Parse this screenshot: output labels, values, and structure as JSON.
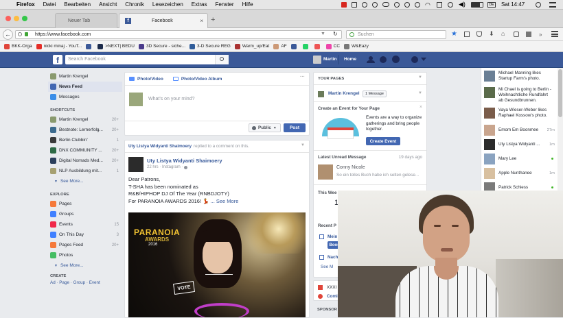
{
  "macos": {
    "app": "Firefox",
    "menus": [
      "Datei",
      "Bearbeiten",
      "Ansicht",
      "Chronik",
      "Lesezeichen",
      "Extras",
      "Fenster",
      "Hilfe"
    ],
    "clock": "Sat 14:47"
  },
  "tabs": [
    {
      "label": "Neuer Tab",
      "active": false
    },
    {
      "label": "Facebook",
      "active": true
    }
  ],
  "url": "https://www.facebook.com",
  "search_placeholder": "Suchen",
  "bookmarks": [
    "BKK-Orga",
    "nicki minaj - YouT...",
    "",
    ">NEXT| BEDU",
    "3D Secure - siche...",
    "3-D Secure REG",
    "Warm_up/Eat",
    "AF",
    "",
    "",
    "",
    "CC",
    "W&Eazy"
  ],
  "fb": {
    "search_placeholder": "Search Facebook",
    "user_name": "Martin",
    "home": "Home",
    "left": {
      "profile": "Martin Krengel",
      "main": [
        {
          "label": "News Feed",
          "count": ""
        },
        {
          "label": "Messages",
          "count": ""
        }
      ],
      "shortcuts_title": "SHORTCUTS",
      "shortcuts": [
        {
          "label": "Martin Krengel",
          "count": "20+"
        },
        {
          "label": "Bestnote: Lernerfolg...",
          "count": "20+"
        },
        {
          "label": "Berlin Clubbin'",
          "count": "1"
        },
        {
          "label": "DNX COMMUNITY ...",
          "count": "20+"
        },
        {
          "label": "Digital Nomads Med...",
          "count": "20+"
        },
        {
          "label": "NLP Ausbildung mit...",
          "count": "1"
        }
      ],
      "see_more": "See More...",
      "explore_title": "EXPLORE",
      "explore": [
        {
          "label": "Pages",
          "count": ""
        },
        {
          "label": "Groups",
          "count": ""
        },
        {
          "label": "Events",
          "count": "15"
        },
        {
          "label": "On This Day",
          "count": "3"
        },
        {
          "label": "Pages Feed",
          "count": "20+"
        },
        {
          "label": "Photos",
          "count": ""
        }
      ],
      "see_more2": "See More...",
      "create_title": "CREATE",
      "create_links": "Ad · Page · Group · Event"
    },
    "composer": {
      "tab_photo": "Photo/Video",
      "tab_album": "Photo/Video Album",
      "placeholder": "What's on your mind?",
      "privacy": "Public",
      "post": "Post"
    },
    "story": {
      "header_name": "Uty Listya Widyanti Shaimoery",
      "header_text": "replied to a comment on this.",
      "author": "Uty Listya Widyanti Shaimoery",
      "meta": "22 hrs · Instagram · ",
      "lines": [
        "Dear Patrons,",
        "T-SHA has been nominated as",
        "R&B/HIPHOP DJ Of The Year (RNBDJOTY)",
        "For PARANOIA AWARDS 2016!"
      ],
      "see_more": "... See More",
      "image_title": "PARANOIA",
      "image_sub": "AWARDS",
      "image_year": "2016",
      "vote": "VOTE"
    },
    "right": {
      "your_pages": "YOUR PAGES",
      "page_name": "Martin Krengel",
      "message_badge": "1 Message",
      "create_event_title": "Create an Event for Your Page",
      "create_event_text": "Events are a way to organize gatherings and bring people together.",
      "create_event_btn": "Create Event",
      "latest_title": "Latest Unread Message",
      "latest_time": "19 days ago",
      "latest_name": "Conny Nicole",
      "latest_text": "So ein tolles Buch habe ich selten gelese...",
      "this_week": "This Wee",
      "this_week_num": "1",
      "recent": "Recent P",
      "mein": "Mein",
      "boost": "Boos",
      "nach": "Nach",
      "see_m": "See M",
      "xxxi": "XXXI T",
      "comin": "Comin",
      "sponsor": "SPONSOR"
    },
    "chat": [
      {
        "name": "Michael Manning likes Startup Farm's photo.",
        "time": ""
      },
      {
        "name": "Mi Chael is going to Berlin - Weihnachtliche Rundfahrt ab Gesundbrunnen.",
        "time": ""
      },
      {
        "name": "Vaya Wieser-Weber likes Raphael Kossow's photo.",
        "time": ""
      },
      {
        "name": "Emom Em Boonmee",
        "time": "27m"
      },
      {
        "name": "Uty Listya Widyanti ...",
        "time": "1m"
      },
      {
        "name": "Mary Lee",
        "time": ""
      },
      {
        "name": "Apple Nunthanee",
        "time": "1m"
      },
      {
        "name": "Patrick Schiess",
        "time": ""
      }
    ]
  },
  "colors": {
    "fb_blue": "#3b5998",
    "accent": "#4267b2"
  }
}
